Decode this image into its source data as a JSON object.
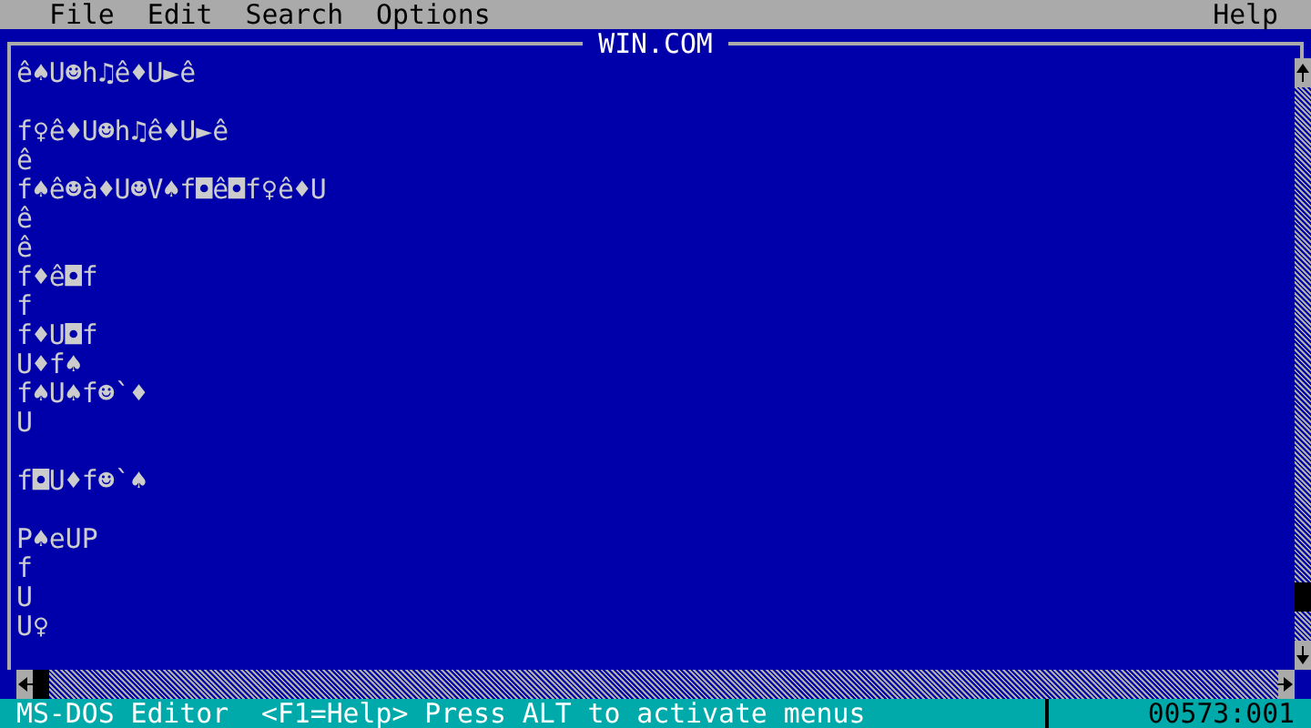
{
  "menu": [
    {
      "label": "File"
    },
    {
      "label": "Edit"
    },
    {
      "label": "Search"
    },
    {
      "label": "Options"
    }
  ],
  "help_menu": {
    "label": "Help"
  },
  "document": {
    "title": "WIN.COM",
    "lines": [
      {
        "kind": "text",
        "text": "ê♠U☻h♫ê♦U►ê"
      },
      {
        "kind": "blank"
      },
      {
        "kind": "text",
        "text": "f♀ê♦U☻h♫ê♦U►ê"
      },
      {
        "kind": "text",
        "text": "ê"
      },
      {
        "kind": "text",
        "text": "f♠ê☻à♦U☻V♠f◘ê◘f♀ê♦U"
      },
      {
        "kind": "text",
        "text": "ê"
      },
      {
        "kind": "text",
        "text": "ê"
      },
      {
        "kind": "text",
        "text": "f♦ê◘f"
      },
      {
        "kind": "text",
        "text": "f"
      },
      {
        "kind": "text",
        "text": "f♦U◘f"
      },
      {
        "kind": "text",
        "text": "U♦f♠"
      },
      {
        "kind": "text",
        "text": "f♠U♠f☻`♦"
      },
      {
        "kind": "text",
        "text": "U"
      },
      {
        "kind": "blank"
      },
      {
        "kind": "text",
        "text": "f◘U♦f☻`♠"
      },
      {
        "kind": "blank"
      },
      {
        "kind": "text",
        "text": "P♠eUP"
      },
      {
        "kind": "text",
        "text": "f"
      },
      {
        "kind": "text",
        "text": "U"
      },
      {
        "kind": "text",
        "text": "U♀"
      }
    ]
  },
  "status_bar": {
    "app": "MS-DOS Editor",
    "hint": "<F1=Help> Press ALT to activate menus",
    "position": "00573:001"
  }
}
